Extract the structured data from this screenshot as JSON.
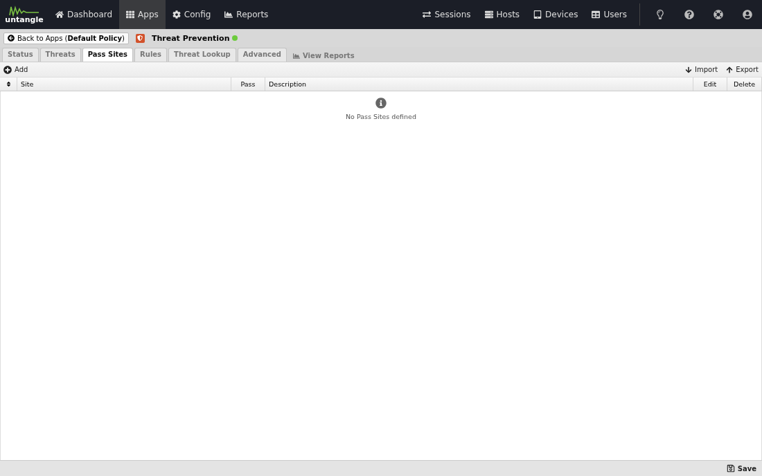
{
  "logo": {
    "text": "untangle"
  },
  "nav_left": [
    {
      "label": "Dashboard",
      "selected": false
    },
    {
      "label": "Apps",
      "selected": true
    },
    {
      "label": "Config",
      "selected": false
    },
    {
      "label": "Reports",
      "selected": false
    }
  ],
  "nav_right": [
    {
      "label": "Sessions"
    },
    {
      "label": "Hosts"
    },
    {
      "label": "Devices"
    },
    {
      "label": "Users"
    }
  ],
  "back_button": {
    "text": "Back to Apps (**Default Policy**)"
  },
  "app": {
    "title": "Threat Prevention",
    "enabled": true
  },
  "tabs": [
    {
      "label": "Status",
      "selected": false
    },
    {
      "label": "Threats",
      "selected": false
    },
    {
      "label": "Pass Sites",
      "selected": true
    },
    {
      "label": "Rules",
      "selected": false
    },
    {
      "label": "Threat Lookup",
      "selected": false
    },
    {
      "label": "Advanced",
      "selected": false
    }
  ],
  "view_reports": "View Reports",
  "toolbar": {
    "add": "Add",
    "import": "Import",
    "export": "Export"
  },
  "table": {
    "columns": [
      "Site",
      "Pass",
      "Description",
      "Edit",
      "Delete"
    ],
    "empty_message": "No Pass Sites defined"
  },
  "footer": {
    "save": "Save"
  }
}
